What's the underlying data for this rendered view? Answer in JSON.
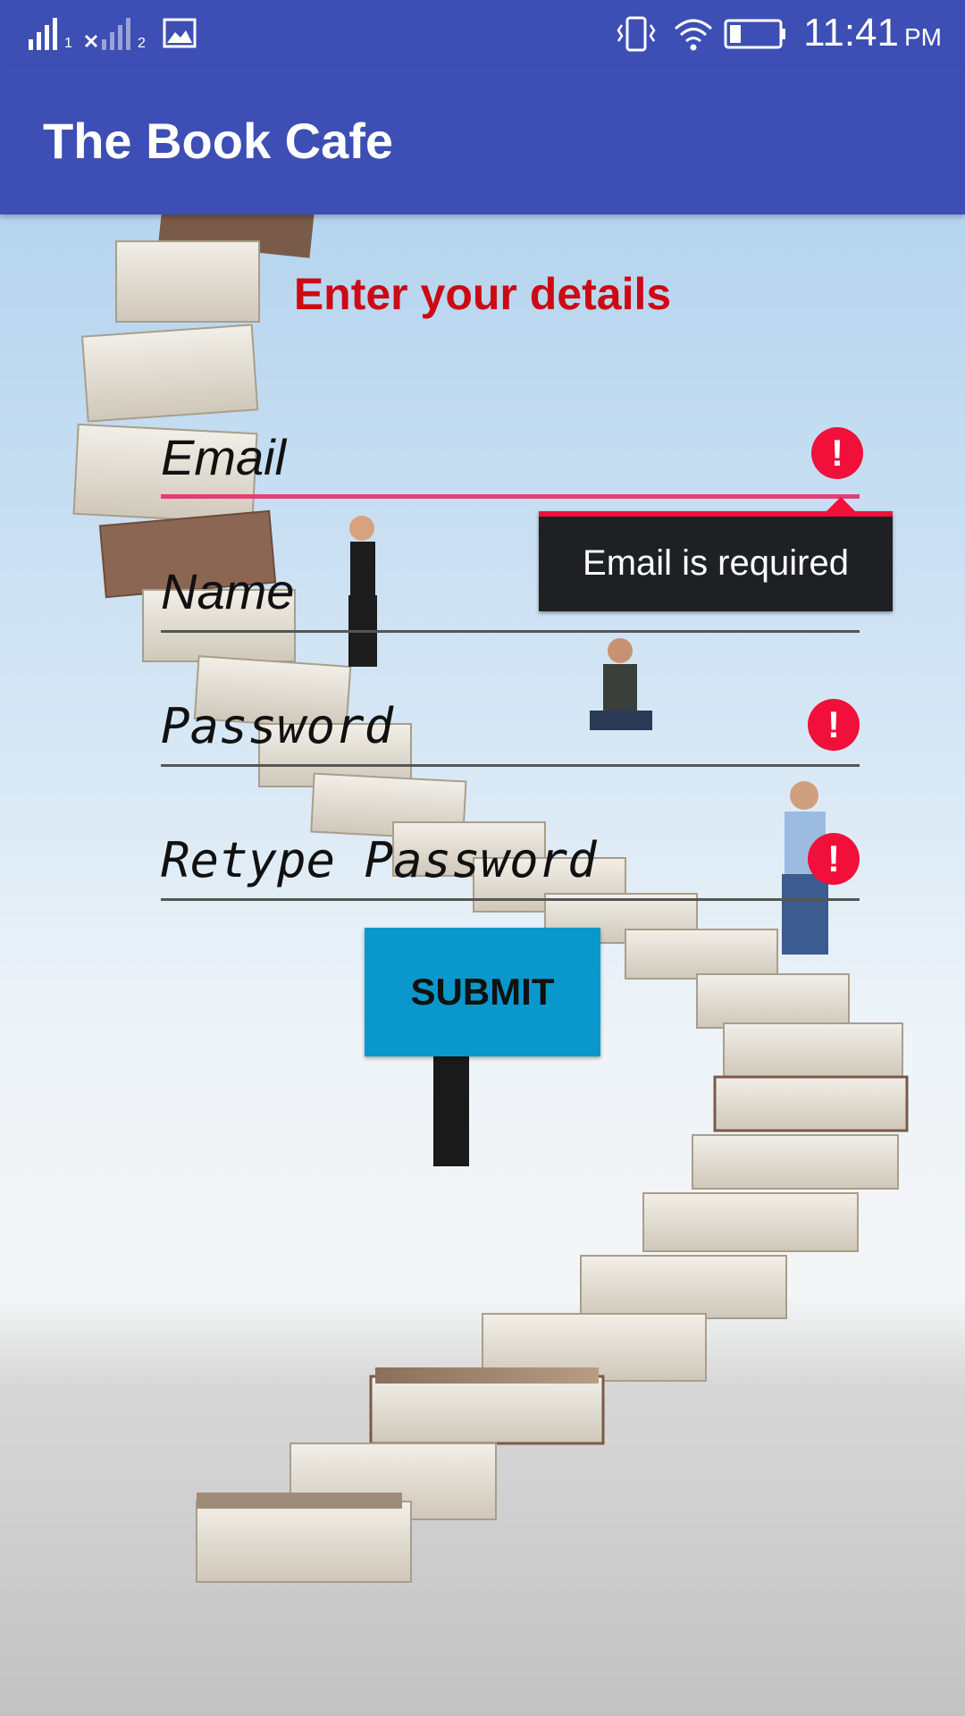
{
  "status_bar": {
    "time": "11:41",
    "ampm": "PM",
    "sim1_label": "1",
    "sim2_label": "2",
    "icons": [
      "signal-icon",
      "no-signal-icon",
      "image-icon",
      "vibrate-icon",
      "wifi-icon",
      "battery-icon"
    ]
  },
  "app_bar": {
    "title": "The Book Cafe"
  },
  "form": {
    "heading": "Enter your details",
    "fields": [
      {
        "hint": "Email",
        "has_error": true,
        "focused": true
      },
      {
        "hint": "Name",
        "has_error": false,
        "focused": false
      },
      {
        "hint": "Password",
        "has_error": true,
        "focused": false
      },
      {
        "hint": "Retype Password",
        "has_error": true,
        "focused": false
      }
    ],
    "error_tooltip": "Email is required",
    "error_icon_glyph": "!",
    "submit_label": "SUBMIT"
  },
  "colors": {
    "primary": "#3d4fb4",
    "heading": "#cc0a14",
    "error": "#f0103a",
    "focus_underline": "#e23f76",
    "button": "#0a98cc"
  }
}
